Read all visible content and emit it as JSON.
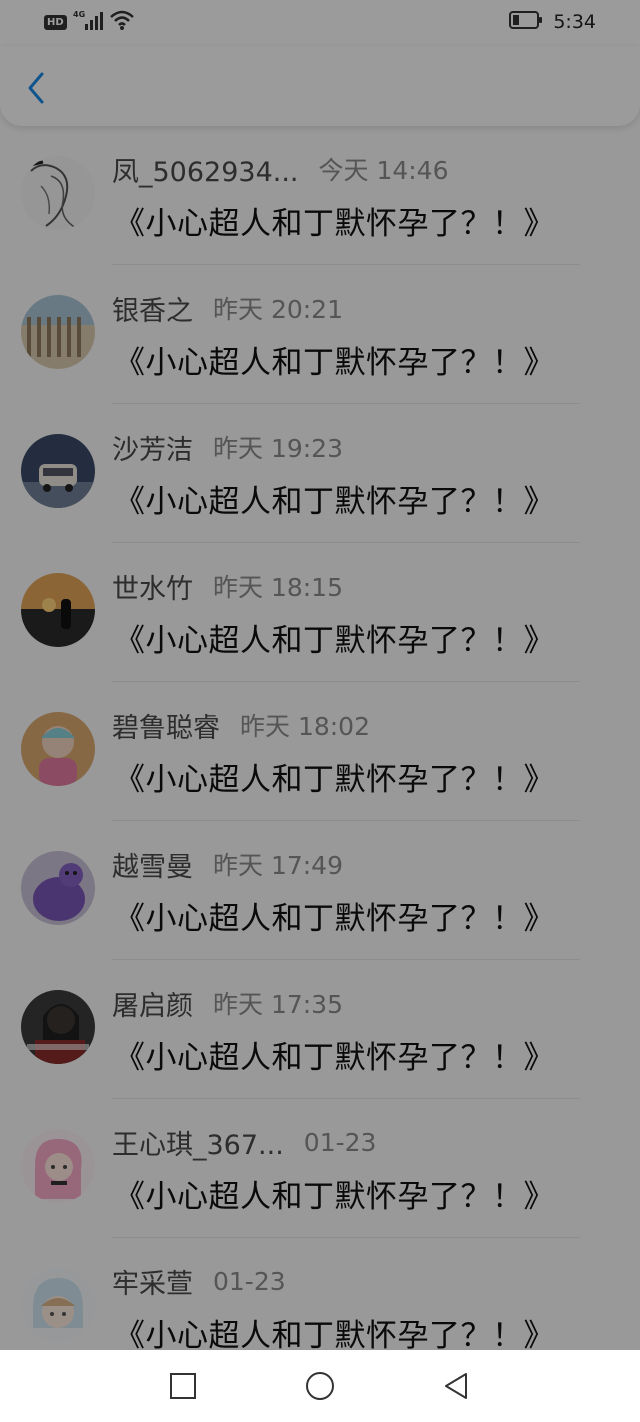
{
  "status_bar": {
    "network_badge": "HD",
    "network_type": "4G",
    "time": "5:34",
    "icons": [
      "hd-icon",
      "signal-icon",
      "wifi-icon",
      "battery-icon"
    ]
  },
  "header": {
    "back_icon": "chevron-left-icon"
  },
  "messages": [
    {
      "name": "凤_5062934...",
      "time": "今天 14:46",
      "text": "《小心超人和丁默怀孕了？！》"
    },
    {
      "name": "银香之",
      "time": "昨天 20:21",
      "text": "《小心超人和丁默怀孕了？！》"
    },
    {
      "name": "沙芳洁",
      "time": "昨天 19:23",
      "text": "《小心超人和丁默怀孕了？！》"
    },
    {
      "name": "世水竹",
      "time": "昨天 18:15",
      "text": "《小心超人和丁默怀孕了？！》"
    },
    {
      "name": "碧鲁聪睿",
      "time": "昨天 18:02",
      "text": "《小心超人和丁默怀孕了？！》"
    },
    {
      "name": "越雪曼",
      "time": "昨天 17:49",
      "text": "《小心超人和丁默怀孕了？！》"
    },
    {
      "name": "屠启颜",
      "time": "昨天 17:35",
      "text": "《小心超人和丁默怀孕了？！》"
    },
    {
      "name": "王心琪_367...",
      "time": "01-23",
      "text": "《小心超人和丁默怀孕了？！》"
    },
    {
      "name": "牢采萱",
      "time": "01-23",
      "text": "《小心超人和丁默怀孕了？！》"
    }
  ],
  "nav_bar": {
    "icons": [
      "recent-apps-icon",
      "home-icon",
      "back-icon"
    ]
  },
  "colors": {
    "accent": "#1a88e6",
    "overlay": "#000000"
  }
}
